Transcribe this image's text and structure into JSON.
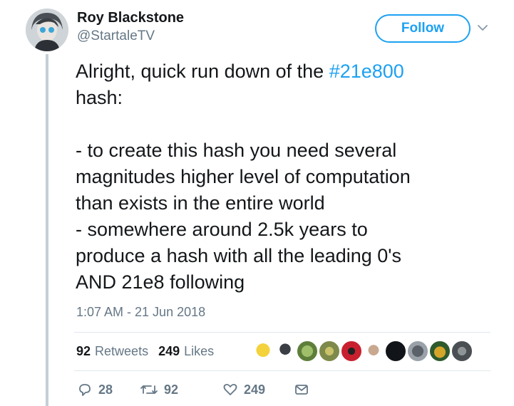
{
  "author": {
    "name": "Roy Blackstone",
    "handle": "@StartaleTV"
  },
  "follow_label": "Follow",
  "tweet": {
    "line1_prefix": "Alright, quick run down of the ",
    "hashtag": "#21e800",
    "line1_suffix": "\nhash:",
    "body": "- to create this hash you need several\nmagnitudes higher level of computation\nthan exists in the entire world\n- somewhere around 2.5k years to\nproduce a hash with all the leading 0's\nAND 21e8 following"
  },
  "timestamp": "1:07 AM - 21 Jun 2018",
  "stats": {
    "retweets_count": "92",
    "retweets_label": "Retweets",
    "likes_count": "249",
    "likes_label": "Likes"
  },
  "actions": {
    "replies": "28",
    "retweets": "92",
    "likes": "249"
  },
  "colors": {
    "accent": "#1da1f2",
    "muted": "#657786",
    "text": "#14171a"
  },
  "icons": [
    "chevron-down-icon",
    "reply-icon",
    "retweet-icon",
    "heart-icon",
    "direct-message-icon"
  ]
}
